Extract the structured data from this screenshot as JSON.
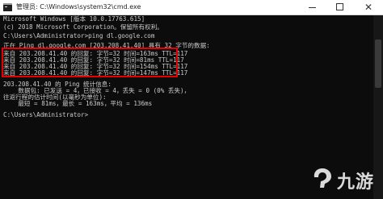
{
  "window": {
    "title": "管理员: C:\\Windows\\system32\\cmd.exe"
  },
  "console": {
    "lines": [
      "Microsoft Windows [版本 10.0.17763.615]",
      "(c) 2018 Microsoft Corporation。保留所有权利。",
      "",
      "C:\\Users\\Administrator>ping dl.google.com",
      "",
      "正在 Ping dl.google.com [203.208.41.40] 具有 32 字节的数据:",
      "来自 203.208.41.40 的回复: 字节=32 时间=163ms TTL=117",
      "来自 203.208.41.40 的回复: 字节=32 时间=81ms TTL=117",
      "来自 203.208.41.40 的回复: 字节=32 时间=154ms TTL=117",
      "来自 203.208.41.40 的回复: 字节=32 时间=147ms TTL=117",
      "",
      "203.208.41.40 的 Ping 统计信息:",
      "    数据包: 已发送 = 4，已接收 = 4，丢失 = 0 (0% 丢失)，",
      "往返行程的估计时间(以毫秒为单位):",
      "    最短 = 81ms，最长 = 163ms，平均 = 136ms",
      "",
      "C:\\Users\\Administrator>"
    ]
  },
  "watermark": {
    "text": "九游"
  },
  "colors": {
    "console_bg": "#0c0c0c",
    "console_fg": "#cccccc",
    "highlight": "#e60000"
  }
}
